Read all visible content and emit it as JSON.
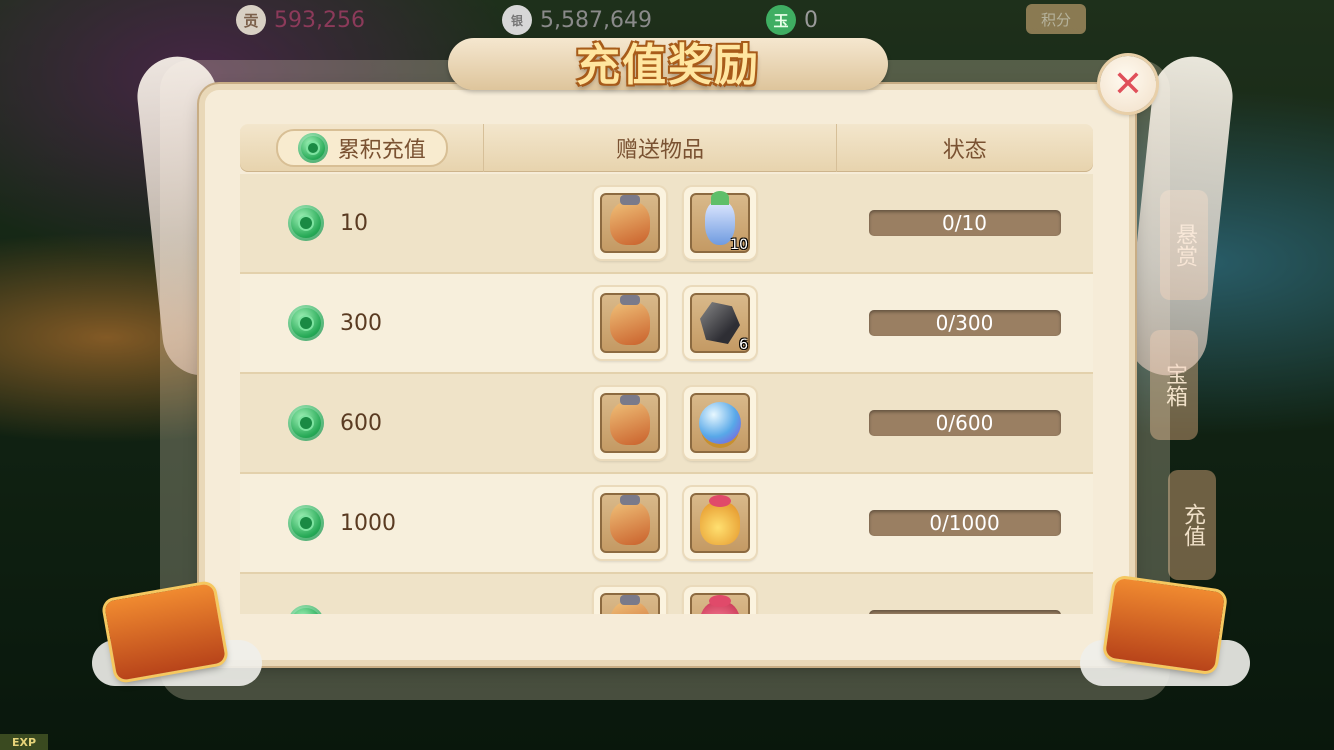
{
  "top_bar": {
    "contribution": {
      "icon": "贡",
      "value": "593,256"
    },
    "silver": {
      "icon": "银",
      "value": "5,587,649"
    },
    "jade": {
      "icon": "玉",
      "value": "0"
    },
    "points_label": "积分"
  },
  "side_buttons": {
    "btn1": "悬赏",
    "btn2": "宝箱",
    "btn3": "充值"
  },
  "exp_label": "EXP",
  "dialog": {
    "title": "充值奖励",
    "close_symbol": "✕"
  },
  "table": {
    "headers": {
      "cumulative": "累积充值",
      "gifts": "赠送物品",
      "status": "状态"
    },
    "rows": [
      {
        "amount": "10",
        "items": [
          {
            "icon": "money-bag-icon",
            "qty": ""
          },
          {
            "icon": "flower-vase-icon",
            "qty": "10"
          }
        ],
        "status": "0/10",
        "progress": 0
      },
      {
        "amount": "300",
        "items": [
          {
            "icon": "money-bag-icon",
            "qty": ""
          },
          {
            "icon": "dark-stone-icon",
            "qty": "6"
          }
        ],
        "status": "0/300",
        "progress": 0
      },
      {
        "amount": "600",
        "items": [
          {
            "icon": "money-bag-icon",
            "qty": ""
          },
          {
            "icon": "crystal-orb-icon",
            "qty": ""
          }
        ],
        "status": "0/600",
        "progress": 0
      },
      {
        "amount": "1000",
        "items": [
          {
            "icon": "money-bag-icon",
            "qty": ""
          },
          {
            "icon": "gold-pouch-icon",
            "qty": ""
          }
        ],
        "status": "0/1000",
        "progress": 0
      },
      {
        "amount": "",
        "items": [
          {
            "icon": "money-bag-icon",
            "qty": ""
          },
          {
            "icon": "red-pouch-icon",
            "qty": ""
          }
        ],
        "status": "",
        "progress": 0
      }
    ]
  },
  "colors": {
    "panel_bg": "#f6ecd8",
    "title_text": "#ffe6a0",
    "header_text": "#7a5232",
    "status_bar": "#9a7f62",
    "close_x": "#e0505a",
    "jade_green": "#26a956"
  }
}
